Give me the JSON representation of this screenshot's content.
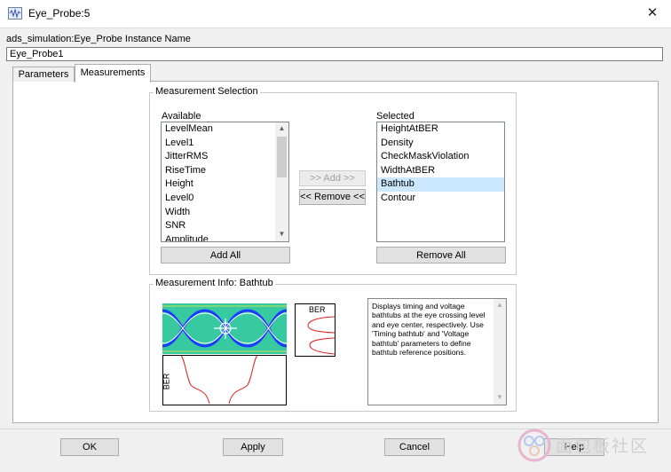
{
  "window": {
    "title": "Eye_Probe:5",
    "close_symbol": "✕"
  },
  "instance": {
    "label": "ads_simulation:Eye_Probe Instance Name",
    "value": "Eye_Probe1"
  },
  "tabs": [
    {
      "label": "Parameters"
    },
    {
      "label": "Measurements"
    }
  ],
  "measurement_selection": {
    "title": "Measurement Selection",
    "available_label": "Available",
    "available": [
      "LevelMean",
      "Level1",
      "JitterRMS",
      "RiseTime",
      "Height",
      "Level0",
      "Width",
      "SNR",
      "Amplitude"
    ],
    "selected_label": "Selected",
    "selected": [
      "HeightAtBER",
      "Density",
      "CheckMaskViolation",
      "WidthAtBER",
      "Bathtub",
      "Contour"
    ],
    "selected_item": "Bathtub",
    "add_label": ">> Add >>",
    "remove_label": "<< Remove <<",
    "add_all_label": "Add All",
    "remove_all_label": "Remove All"
  },
  "measurement_info": {
    "title": "Measurement Info: Bathtub",
    "ber_label": "BER",
    "ber_vertical_label": "BER",
    "description": "Displays timing and voltage bathtubs at the eye crossing level and eye center, respectively. Use 'Timing bathtub' and 'Voltage bathtub' parameters to define bathtub reference positions."
  },
  "footer": {
    "ok_label": "OK",
    "apply_label": "Apply",
    "cancel_label": "Cancel",
    "help_label": "Help"
  },
  "watermark": {
    "text": "面包板社区"
  },
  "colors": {
    "selection": "#cce8ff",
    "curve": "#e02020",
    "eye_blue": "#1a3cff",
    "eye_green": "#2fd29a",
    "accent": "#0078d7"
  }
}
